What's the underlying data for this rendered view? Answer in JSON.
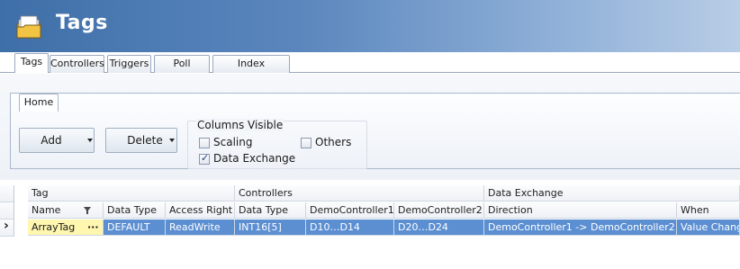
{
  "header": {
    "title": "Tags",
    "icon": "tags-folder-icon"
  },
  "tabs": [
    {
      "label": "Tags",
      "active": true
    },
    {
      "label": "Controllers",
      "active": false
    },
    {
      "label": "Triggers",
      "active": false
    },
    {
      "label": "Poll Groups",
      "active": false
    },
    {
      "label": "Index Registers",
      "active": false
    }
  ],
  "ribbon": {
    "home_tab": "Home",
    "add_label": "Add",
    "delete_label": "Delete",
    "columns_visible": {
      "title": "Columns Visible",
      "scaling": {
        "label": "Scaling",
        "checked": false
      },
      "others": {
        "label": "Others",
        "checked": false
      },
      "data_exchange": {
        "label": "Data Exchange",
        "checked": true
      }
    }
  },
  "grid": {
    "groups": {
      "tag": "Tag",
      "controllers": "Controllers",
      "data_exchange": "Data Exchange"
    },
    "columns": {
      "name": "Name",
      "data_type": "Data Type",
      "access_right": "Access Right",
      "ctrl_data_type": "Data Type",
      "demo1": "DemoController1",
      "demo2": "DemoController2",
      "direction": "Direction",
      "when": "When"
    },
    "row": {
      "name": "ArrayTag",
      "ellipsis": "···",
      "data_type": "DEFAULT",
      "access_right": "ReadWrite",
      "ctrl_data_type": "INT16[5]",
      "demo1": "D10…D14",
      "demo2": "D20…D24",
      "direction": "DemoController1 -> DemoController2",
      "when": "Value Change"
    },
    "row_indicator": "›",
    "filter_icon": "filter-funnel-icon"
  },
  "colors": {
    "header_start": "#3f6fa8",
    "selection": "#5b8fd2"
  }
}
